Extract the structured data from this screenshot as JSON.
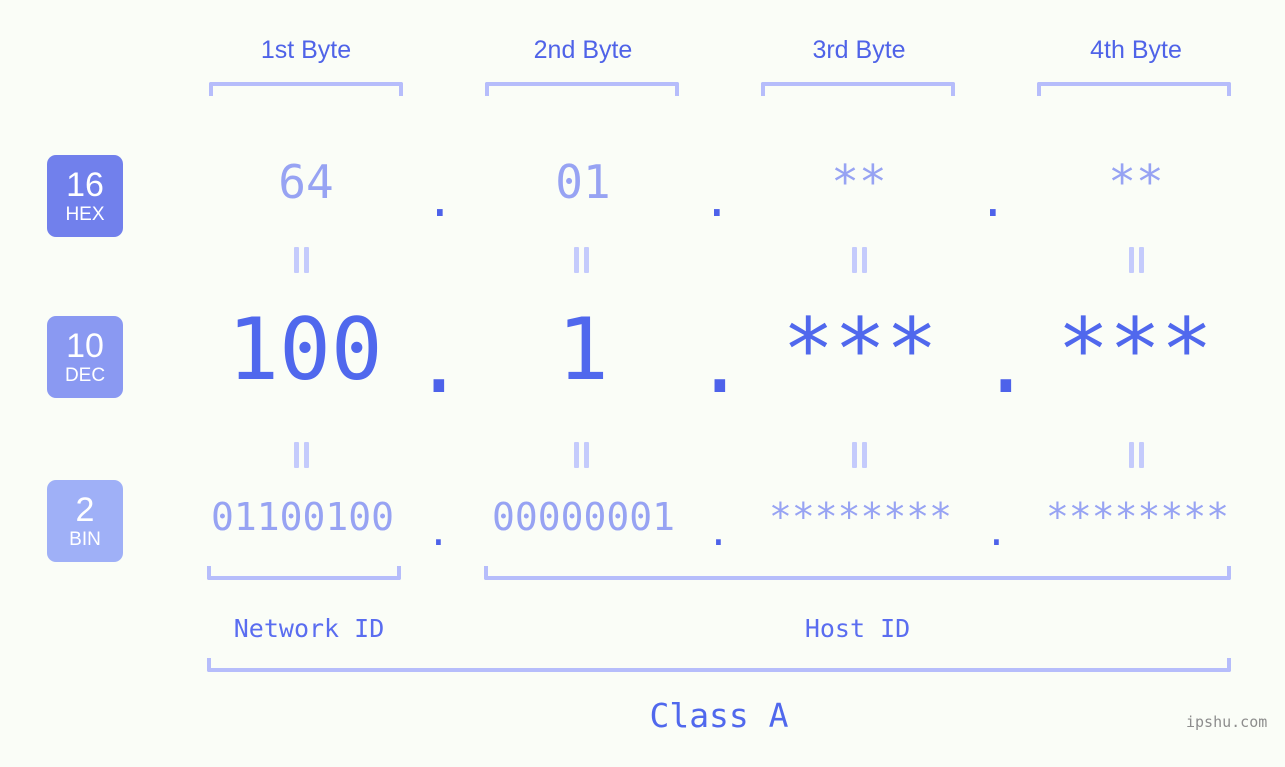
{
  "colors": {
    "background": "#fafdf7",
    "accent_strong": "#4f63e8",
    "accent_mid": "#8a99f2",
    "accent_light": "#b6bdfb",
    "badge_hex": "#7180ec",
    "badge_dec": "#8a99f2",
    "badge_bin": "#9fb0f7",
    "value_light": "#97a3f3",
    "value_strong": "#5068ed",
    "watermark": "#8d8d8d"
  },
  "byte_headers": [
    {
      "label": "1st Byte"
    },
    {
      "label": "2nd Byte"
    },
    {
      "label": "3rd Byte"
    },
    {
      "label": "4th Byte"
    }
  ],
  "bases": [
    {
      "num": "16",
      "name": "HEX"
    },
    {
      "num": "10",
      "name": "DEC"
    },
    {
      "num": "2",
      "name": "BIN"
    }
  ],
  "rows": {
    "hex": {
      "base_num": "16",
      "base_name": "HEX",
      "values": [
        "64",
        "01",
        "**",
        "**"
      ],
      "separator": "."
    },
    "dec": {
      "base_num": "10",
      "base_name": "DEC",
      "values": [
        "100",
        "1",
        "***",
        "***"
      ],
      "separator": "."
    },
    "bin": {
      "base_num": "2",
      "base_name": "BIN",
      "values": [
        "01100100",
        "00000001",
        "********",
        "********"
      ],
      "separator": "."
    }
  },
  "equals_marks": {
    "glyph": "=",
    "count_per_row": 4
  },
  "segments": {
    "network_id": "Network ID",
    "host_id": "Host ID",
    "class": "Class A"
  },
  "watermark": "ipshu.com"
}
